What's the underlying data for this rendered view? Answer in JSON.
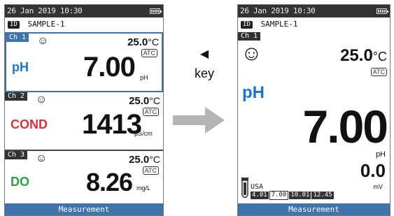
{
  "left_screen": {
    "status": {
      "datetime": "26 Jan 2019 10:30"
    },
    "id": {
      "badge": "ID",
      "sample": "SAMPLE-1"
    },
    "channels": [
      {
        "badge": "Ch 1",
        "temp": "25.0",
        "temp_unit": "°C",
        "atc": "ATC",
        "param": "pH",
        "param_color": "#1a73d9",
        "value": "7.00",
        "unit": "pH"
      },
      {
        "badge": "Ch 2",
        "temp": "25.0",
        "temp_unit": "°C",
        "atc": "ATC",
        "param": "COND",
        "param_color": "#e0303a",
        "value": "1413",
        "unit": "µS/cm"
      },
      {
        "badge": "Ch 3",
        "temp": "25.0",
        "temp_unit": "°C",
        "atc": "ATC",
        "param": "DO",
        "param_color": "#2aa344",
        "value": "8.26",
        "unit": "mg/L"
      }
    ],
    "footer": "Measurement"
  },
  "key": {
    "arrow": "◀",
    "label": "key"
  },
  "right_screen": {
    "status": {
      "datetime": "26 Jan 2019 10:30"
    },
    "id": {
      "badge": "ID",
      "sample": "SAMPLE-1"
    },
    "channel_badge": "Ch 1",
    "temp": "25.0",
    "temp_unit": "°C",
    "atc": "ATC",
    "param": "pH",
    "param_color": "#1a73d9",
    "value": "7.00",
    "value_unit": "pH",
    "mv_value": "0.0",
    "mv_unit": "mV",
    "buffer_group": "USA",
    "buffers": [
      "4.01",
      "7.00",
      "10.01",
      "12.45"
    ],
    "footer": "Measurement"
  },
  "colors": {
    "accent": "#3e73ad",
    "arrow": "#b4b4b4"
  }
}
